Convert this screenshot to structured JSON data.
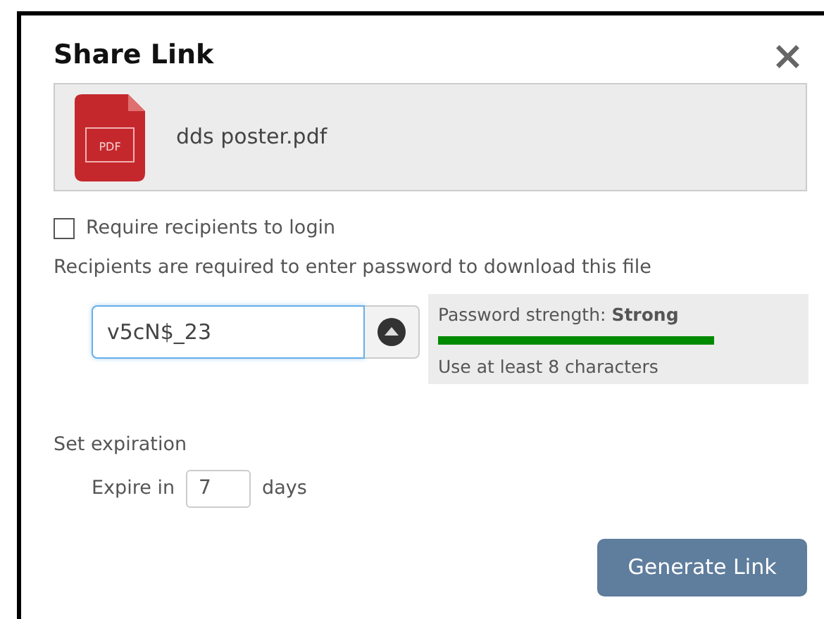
{
  "dialog": {
    "title": "Share Link",
    "close": "×"
  },
  "file": {
    "type": "PDF",
    "name": "dds poster.pdf"
  },
  "require_login": {
    "label": "Require recipients to login",
    "checked": false
  },
  "password_note": "Recipients are required to enter password to download this file",
  "password": {
    "value": "v5cN$_23"
  },
  "strength": {
    "label": "Password strength: **Strong**",
    "hint": "Use at least 8 characters"
  },
  "expiration": {
    "heading": "Set expiration",
    "prefix": "Expire in",
    "value": "7",
    "suffix": "days"
  },
  "button": "Generate Link"
}
